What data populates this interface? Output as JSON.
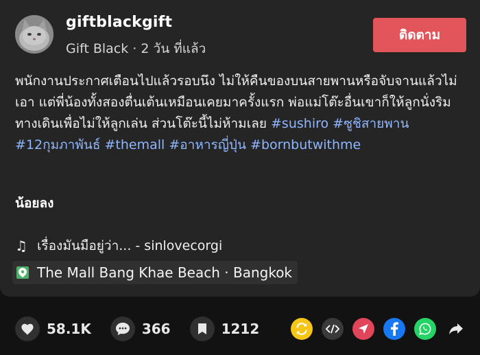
{
  "post": {
    "username": "giftblackgift",
    "display_name": "Gift Black",
    "time_ago": "2 วัน ที่แล้ว",
    "separator": " · ",
    "follow_label": "ติดตาม",
    "caption_text": "พนักงานประกาศเตือนไปแล้วรอบนึง ไม่ให้คืนของบนสายพานหรือจับจานแล้วไม่เอา แต่พี่น้องทั้งสองตื่นเต้นเหมือนเคยมาครั้งแรก พ่อแม่โต๊ะอื่นเขาก็ให้ลูกนั่งริมทางเดินเพื่อไม่ให้ลูกเล่น ส่วนโต๊ะนี้ไม่ห้ามเลย ",
    "hashtags": [
      "#sushiro",
      "#ซูชิสายพาน",
      "#12กุมภาพันธ์",
      "#themall",
      "#อาหารญี่ปุ่น",
      "#bornbutwithme"
    ],
    "see_less_label": "น้อยลง",
    "music": "เรื่องมันมือยู่ว่า... - sinlovecorgi",
    "location": "The Mall Bang Khae Beach · Bangkok"
  },
  "stats": {
    "likes": "58.1K",
    "comments": "366",
    "saves": "1212"
  },
  "icons": {
    "like": "heart-icon",
    "comment": "comment-icon",
    "save": "bookmark-icon",
    "music": "music-note-icon",
    "location": "location-pin-icon",
    "share": [
      "repost-icon",
      "embed-icon",
      "send-icon",
      "facebook-icon",
      "whatsapp-icon",
      "share-arrow-icon"
    ]
  },
  "colors": {
    "accent": "#e2555b",
    "hashtag": "#8fb7ff",
    "repost": "#f5c518",
    "send": "#e0455a",
    "facebook": "#1877f2",
    "whatsapp": "#25d366"
  }
}
